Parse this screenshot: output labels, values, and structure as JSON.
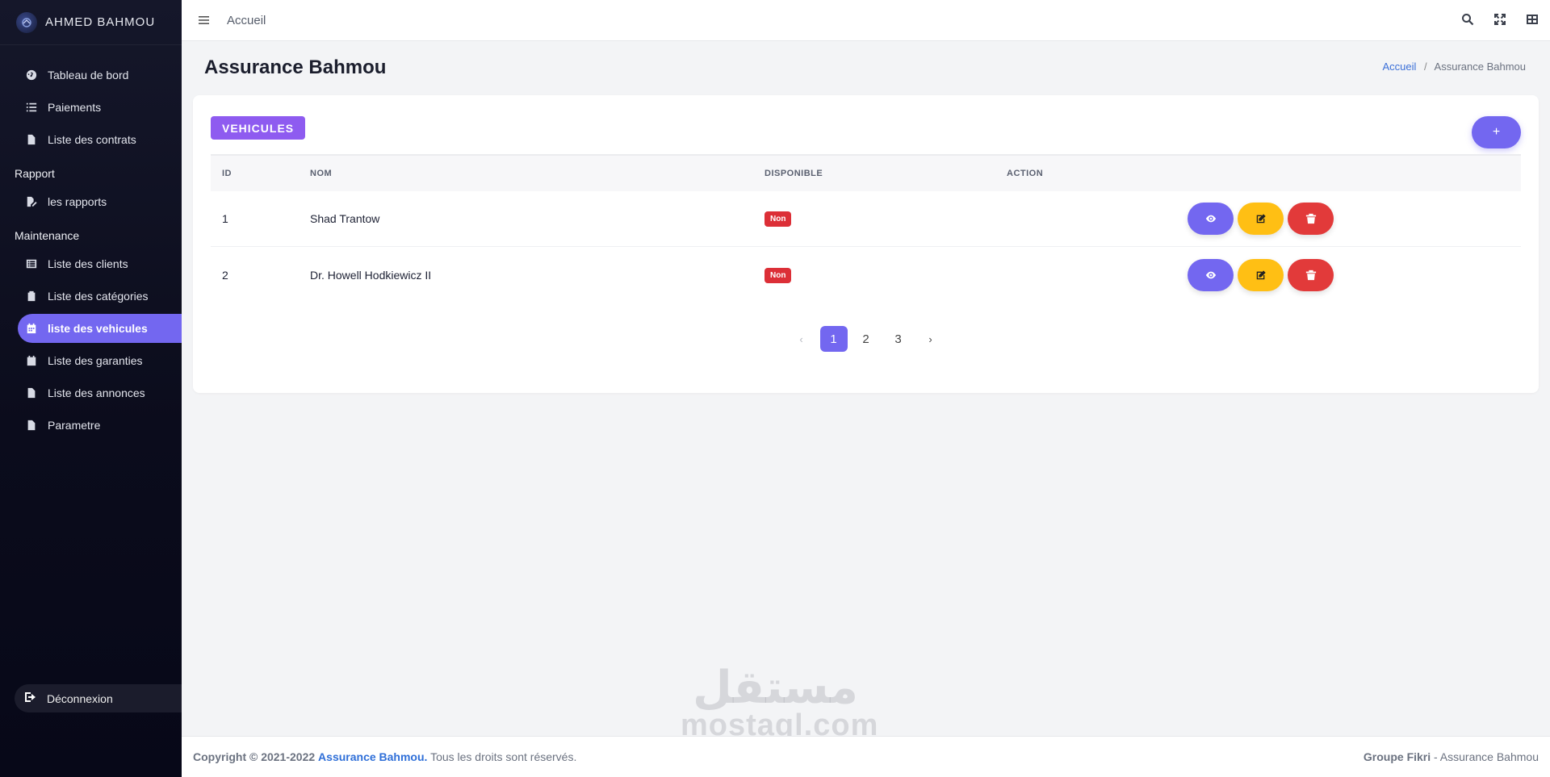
{
  "sidebar": {
    "brand": "AHMED BAHMOU",
    "items": [
      {
        "label": "Tableau de bord",
        "icon": "dashboard-icon"
      },
      {
        "label": "Paiements",
        "icon": "list-icon"
      },
      {
        "label": "Liste des contrats",
        "icon": "file-icon"
      }
    ],
    "section_rapport": "Rapport",
    "rapport_items": [
      {
        "label": "les rapports",
        "icon": "file-edit-icon"
      }
    ],
    "section_maintenance": "Maintenance",
    "maintenance_items": [
      {
        "label": "Liste des clients",
        "icon": "list-alt-icon"
      },
      {
        "label": "Liste des catégories",
        "icon": "clipboard-icon"
      },
      {
        "label": "liste des vehicules",
        "icon": "calendar-icon",
        "active": true
      },
      {
        "label": "Liste des garanties",
        "icon": "calendar-icon"
      },
      {
        "label": "Liste des annonces",
        "icon": "file-icon"
      },
      {
        "label": "Parametre",
        "icon": "file-icon"
      }
    ],
    "logout": "Déconnexion"
  },
  "topbar": {
    "home_link": "Accueil"
  },
  "page": {
    "title": "Assurance Bahmou",
    "breadcrumb": {
      "home": "Accueil",
      "separator": "/",
      "current": "Assurance Bahmou"
    }
  },
  "card": {
    "badge": "VEHICULES",
    "add_label": "+",
    "columns": {
      "id": "ID",
      "nom": "NOM",
      "disponible": "DISPONIBLE",
      "action": "ACTION"
    },
    "rows": [
      {
        "id": "1",
        "nom": "Shad Trantow",
        "disponible": "Non"
      },
      {
        "id": "2",
        "nom": "Dr. Howell Hodkiewicz II",
        "disponible": "Non"
      }
    ],
    "pagination": {
      "prev": "‹",
      "pages": [
        "1",
        "2",
        "3"
      ],
      "next": "›",
      "current": "1"
    }
  },
  "watermark": {
    "arabic": "مستقل",
    "latin": "mostaql.com"
  },
  "footer": {
    "copyright": "Copyright © 2021-2022",
    "brand": "Assurance Bahmou.",
    "rights": "Tous les droits sont réservés.",
    "right_strong": "Groupe Fikri",
    "right_rest": "- Assurance Bahmou"
  },
  "colors": {
    "primary": "#7367f0",
    "badge": "#8e5bf0",
    "warning": "#ffbf14",
    "danger": "#e23a3a",
    "sidebar": "#0b0c1c"
  }
}
